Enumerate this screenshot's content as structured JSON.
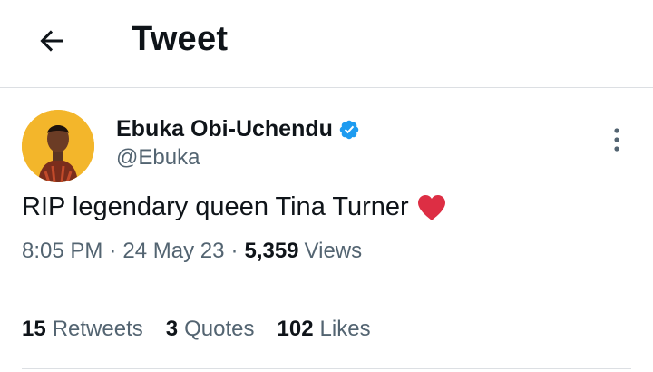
{
  "header": {
    "title": "Tweet",
    "back_icon": "arrow-left-icon"
  },
  "author": {
    "name": "Ebuka Obi-Uchendu",
    "handle": "@Ebuka",
    "verified_icon": "verified-badge-icon",
    "avatar_color": "#f3b62b"
  },
  "tweet": {
    "text": "RIP legendary queen Tina Turner",
    "emoji_icon": "red-heart-icon",
    "time": "8:05 PM",
    "separator": "·",
    "date": "24 May 23",
    "views_count": "5,359",
    "views_label": "Views"
  },
  "stats": {
    "retweets_count": "15",
    "retweets_label": "Retweets",
    "quotes_count": "3",
    "quotes_label": "Quotes",
    "likes_count": "102",
    "likes_label": "Likes"
  },
  "colors": {
    "accent": "#1d9bf0",
    "secondary_text": "#536471",
    "divider": "#dcdfe3",
    "heart": "#dd2e44"
  }
}
